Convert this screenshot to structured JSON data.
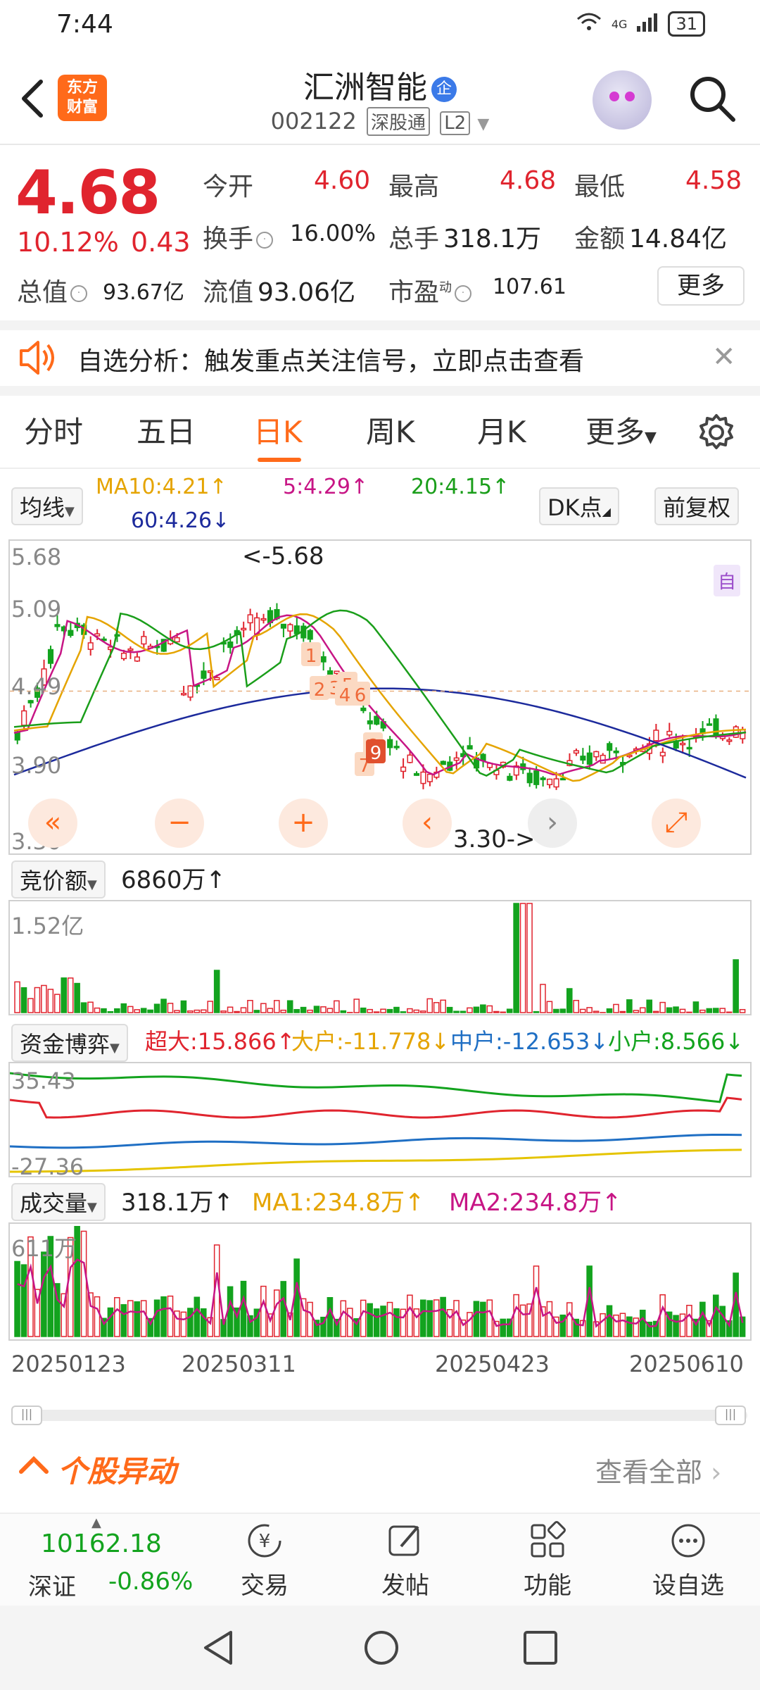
{
  "status": {
    "time": "7:44",
    "signal": "4G",
    "battery": "31"
  },
  "header": {
    "brand": "东方\n财富",
    "brand_line1": "东方",
    "brand_line2": "财富",
    "stock_name": "汇洲智能",
    "corp_badge": "企",
    "stock_code": "002122",
    "tag1": "深股通",
    "tag2": "L2"
  },
  "quote": {
    "price": "4.68",
    "change_pct": "10.12%",
    "change_amt": "0.43",
    "open_label": "今开",
    "open": "4.60",
    "high_label": "最高",
    "high": "4.68",
    "low_label": "最低",
    "low": "4.58",
    "turnover_label": "换手",
    "turnover": "16.00%",
    "volume_label": "总手",
    "volume": "318.1万",
    "amount_label": "金额",
    "amount": "14.84亿",
    "mktcap_label": "总值",
    "mktcap": "93.67亿",
    "float_label": "流值",
    "float": "93.06亿",
    "pe_label": "市盈",
    "pe_sup": "动",
    "pe": "107.61",
    "more": "更多"
  },
  "notice": {
    "text": "自选分析：触发重点关注信号，立即点击查看"
  },
  "tabs": [
    {
      "label": "分时"
    },
    {
      "label": "五日"
    },
    {
      "label": "日K"
    },
    {
      "label": "周K"
    },
    {
      "label": "月K"
    },
    {
      "label": "更多"
    }
  ],
  "indicators": {
    "ma_select": "均线",
    "ma10": "MA10:4.21↑",
    "ma5": "5:4.29↑",
    "ma20": "20:4.15↑",
    "ma60": "60:4.26↓",
    "dk_btn": "DK点",
    "fq_btn": "前复权"
  },
  "kline": {
    "y_labels": [
      "5.68",
      "5.09",
      "4.49",
      "3.90",
      "3.30"
    ],
    "high_note": "<-5.68",
    "low_note": "3.30->",
    "self_tag": "自",
    "markers": [
      "1",
      "2",
      "3",
      "5",
      "4",
      "6",
      "8",
      "7",
      "9"
    ]
  },
  "auction": {
    "select": "竞价额",
    "value": "6860万↑",
    "max_label": "1.52亿"
  },
  "capital": {
    "select": "资金博弈",
    "super_large": "超大:15.866↑",
    "large": "大户:-11.778↓",
    "medium": "中户:-12.653↓",
    "small": "小户:8.566↓",
    "top_label": "35.43",
    "bottom_label": "-27.36"
  },
  "volume": {
    "select": "成交量",
    "value": "318.1万↑",
    "ma1": "MA1:234.8万↑",
    "ma2": "MA2:234.8万↑",
    "max_label": "611万"
  },
  "dates": [
    "20250123",
    "20250311",
    "20250423",
    "20250610"
  ],
  "movement": {
    "title": "个股异动",
    "view_all": "查看全部"
  },
  "bottom_nav": {
    "index_value": "10162.18",
    "index_name": "深证",
    "index_change": "-0.86%",
    "trade": "交易",
    "post": "发帖",
    "function": "功能",
    "watchlist": "设自选"
  },
  "colors": {
    "up": "#e0242e",
    "down": "#13a31e",
    "accent": "#ff6a1a",
    "ma5": "#c71585",
    "ma10": "#e5a400",
    "ma20": "#1a9e1a",
    "ma60": "#1c2a9c"
  }
}
